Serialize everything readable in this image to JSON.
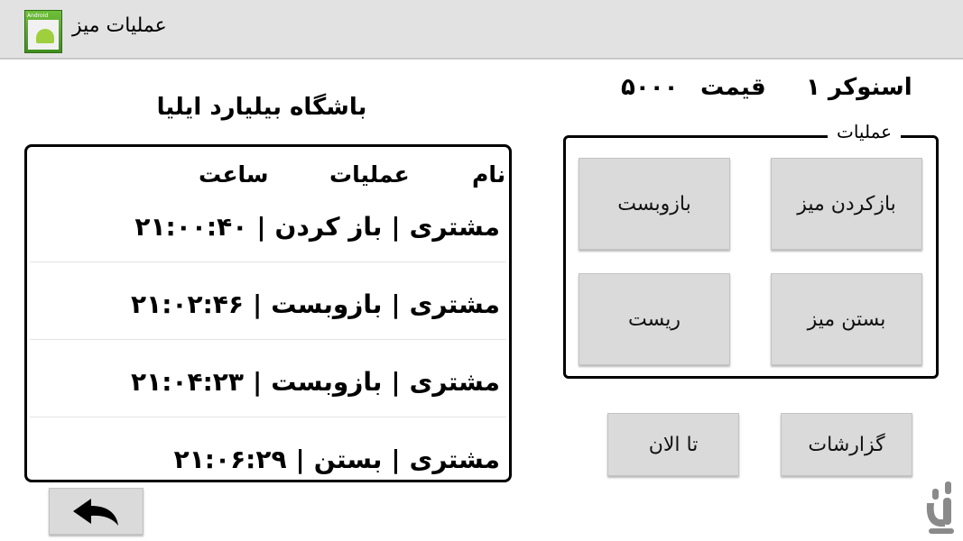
{
  "app": {
    "title": "عملیات میز",
    "icon_tag": "Android"
  },
  "club": {
    "title": "باشگاه بیلیارد ایلیا"
  },
  "table_info": {
    "name": "اسنوکر ۱",
    "price_label": "قیمت",
    "price_value": "۵۰۰۰"
  },
  "log": {
    "headers": {
      "name": "نام",
      "operation": "عملیات",
      "time": "ساعت"
    },
    "rows": [
      {
        "name": "مشتری",
        "operation": "باز کردن",
        "time": "۲۱:۰۰:۴۰"
      },
      {
        "name": "مشتری",
        "operation": "بازوبست",
        "time": "۲۱:۰۲:۴۶"
      },
      {
        "name": "مشتری",
        "operation": "بازوبست",
        "time": "۲۱:۰۴:۲۳"
      },
      {
        "name": "مشتری",
        "operation": "بستن",
        "time": "۲۱:۰۶:۲۹"
      }
    ]
  },
  "operations": {
    "legend": "عملیات",
    "open_table": "بازکردن میز",
    "toggle": "بازوبست",
    "close_table": "بستن میز",
    "reset": "ریست"
  },
  "bottom": {
    "reports": "گزارشات",
    "until_now": "تا الان"
  },
  "icons": {
    "back": "back-arrow-icon",
    "app": "android-app-icon",
    "watermark": "bazaar-logo-icon"
  }
}
